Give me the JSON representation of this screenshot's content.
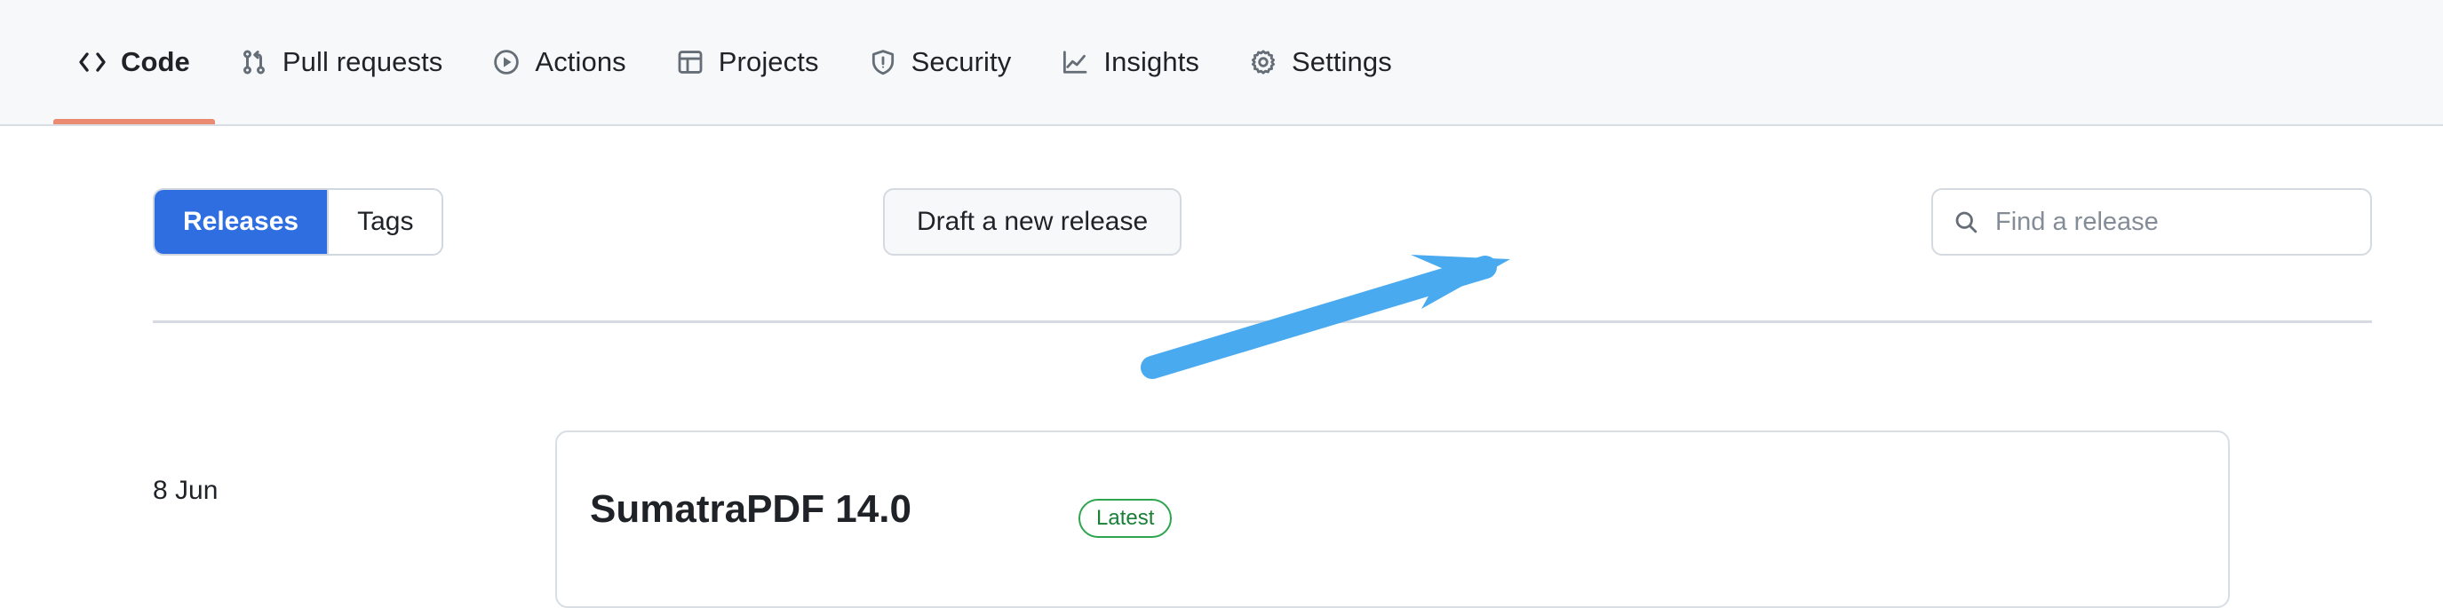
{
  "repo_nav": {
    "tabs": [
      {
        "label": "Code",
        "icon": "code-icon",
        "active": true
      },
      {
        "label": "Pull requests",
        "icon": "git-pull-request-icon",
        "active": false
      },
      {
        "label": "Actions",
        "icon": "play-circle-icon",
        "active": false
      },
      {
        "label": "Projects",
        "icon": "table-icon",
        "active": false
      },
      {
        "label": "Security",
        "icon": "shield-alert-icon",
        "active": false
      },
      {
        "label": "Insights",
        "icon": "graph-line-icon",
        "active": false
      },
      {
        "label": "Settings",
        "icon": "gear-icon",
        "active": false
      }
    ],
    "active_underline_color": "#ea8a71",
    "background_color": "#f6f8fa"
  },
  "toolbar": {
    "segmented": {
      "releases_label": "Releases",
      "tags_label": "Tags",
      "selected": "Releases",
      "selected_color": "#2f6ee0"
    },
    "draft_release_label": "Draft a new release",
    "search": {
      "placeholder": "Find a release",
      "value": "",
      "icon": "search-icon"
    }
  },
  "release_card": {
    "title": "SumatraPDF 14.0",
    "latest_badge": "Latest",
    "sidebar_date": "8 Jun"
  },
  "annotation": {
    "type": "arrow",
    "color": "#4aaaf0",
    "points_to": "Draft a new release"
  }
}
